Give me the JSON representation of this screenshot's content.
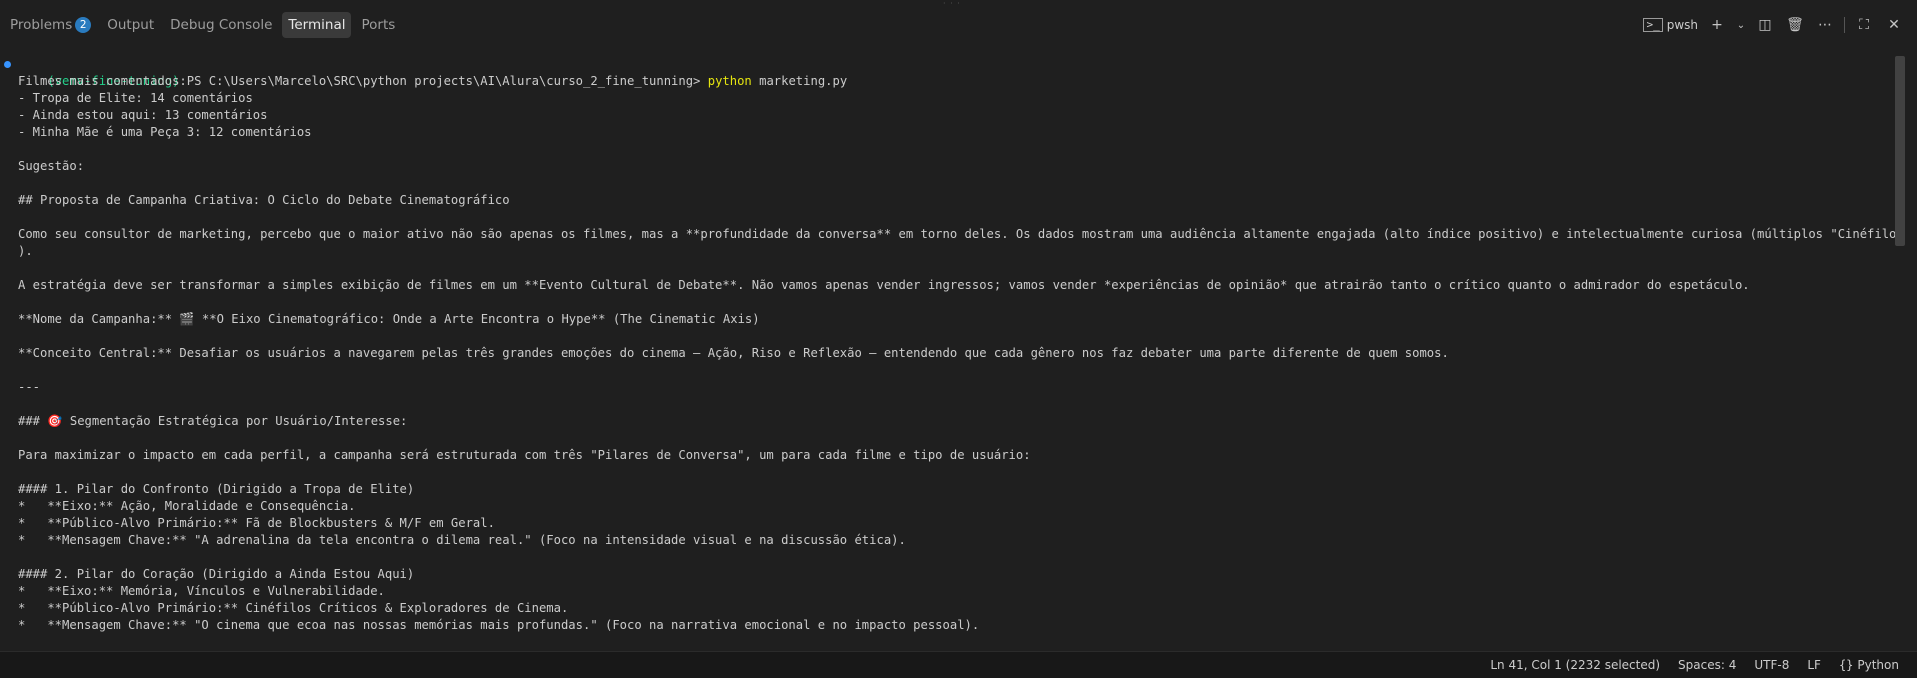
{
  "panel": {
    "tabs": [
      {
        "label": "Problems",
        "badge": "2"
      },
      {
        "label": "Output"
      },
      {
        "label": "Debug Console"
      },
      {
        "label": "Terminal",
        "active": true
      },
      {
        "label": "Ports"
      }
    ],
    "shell_name": "pwsh"
  },
  "terminal": {
    "prompt": {
      "venv": "(venv-fine-tuning)",
      "path": " PS C:\\Users\\Marcelo\\SRC\\python projects\\AI\\Alura\\curso_2_fine_tunning> ",
      "command": "python",
      "args": " marketing.py"
    },
    "lines": [
      "Filmes mais comentados:",
      "- Tropa de Elite: 14 comentários",
      "- Ainda estou aqui: 13 comentários",
      "- Minha Mãe é uma Peça 3: 12 comentários",
      "",
      "Sugestão:",
      "",
      "## Proposta de Campanha Criativa: O Ciclo do Debate Cinematográfico",
      "",
      "Como seu consultor de marketing, percebo que o maior ativo não são apenas os filmes, mas a **profundidade da conversa** em torno deles. Os dados mostram uma audiência altamente engajada (alto índice positivo) e intelectualmente curiosa (múltiplos \"Cinéfilos Críticos\"",
      ").",
      "",
      "A estratégia deve ser transformar a simples exibição de filmes em um **Evento Cultural de Debate**. Não vamos apenas vender ingressos; vamos vender *experiências de opinião* que atrairão tanto o crítico quanto o admirador do espetáculo.",
      "",
      "**Nome da Campanha:** 🎬 **O Eixo Cinematográfico: Onde a Arte Encontra o Hype** (The Cinematic Axis)",
      "",
      "**Conceito Central:** Desafiar os usuários a navegarem pelas três grandes emoções do cinema — Ação, Riso e Reflexão — entendendo que cada gênero nos faz debater uma parte diferente de quem somos.",
      "",
      "---",
      "",
      "### 🎯 Segmentação Estratégica por Usuário/Interesse:",
      "",
      "Para maximizar o impacto em cada perfil, a campanha será estruturada com três \"Pilares de Conversa\", um para cada filme e tipo de usuário:",
      "",
      "#### 1. Pilar do Confronto (Dirigido a Tropa de Elite)",
      "*   **Eixo:** Ação, Moralidade e Consequência.",
      "*   **Público-Alvo Primário:** Fã de Blockbusters & M/F em Geral.",
      "*   **Mensagem Chave:** \"A adrenalina da tela encontra o dilema real.\" (Foco na intensidade visual e na discussão ética).",
      "",
      "#### 2. Pilar do Coração (Dirigido a Ainda Estou Aqui)",
      "*   **Eixo:** Memória, Vínculos e Vulnerabilidade.",
      "*   **Público-Alvo Primário:** Cinéfilos Críticos & Exploradores de Cinema.",
      "*   **Mensagem Chave:** \"O cinema que ecoa nas nossas memórias mais profundas.\" (Foco na narrativa emocional e no impacto pessoal)."
    ]
  },
  "status": {
    "cursor": "Ln 41, Col 1 (2232 selected)",
    "spaces": "Spaces: 4",
    "encoding": "UTF-8",
    "eol": "LF",
    "language": "Python"
  },
  "colors": {
    "background": "#1f1f1f",
    "venv": "#23d18b",
    "command": "#e5e510",
    "badge": "#2a7bbf",
    "dot": "#3794ff"
  },
  "icons": [
    "terminal-shell-icon",
    "add-icon",
    "chevron-down-icon",
    "split-icon",
    "trash-icon",
    "more-icon",
    "maximize-icon",
    "close-icon",
    "braces-icon"
  ]
}
